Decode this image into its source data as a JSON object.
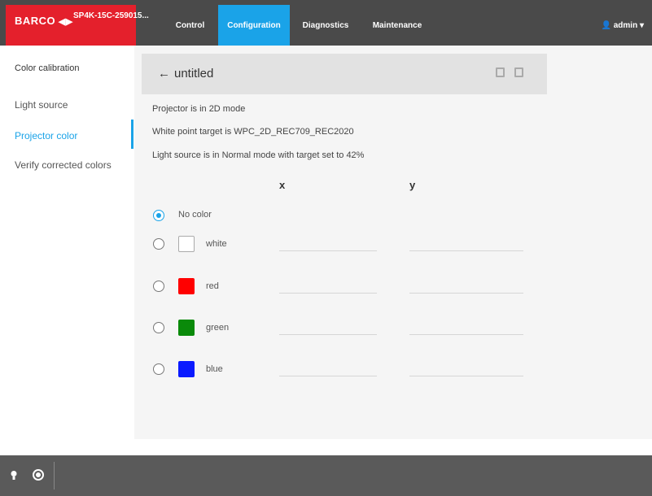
{
  "topbar": {
    "logo": "BARCO",
    "device_name": "SP4K-15C-259015...",
    "tabs": [
      {
        "label": "Control"
      },
      {
        "label": "Configuration"
      },
      {
        "label": "Diagnostics"
      },
      {
        "label": "Maintenance"
      }
    ],
    "user": "admin"
  },
  "sidebar": {
    "title": "Color calibration",
    "items": [
      {
        "label": "Light source"
      },
      {
        "label": "Projector color"
      },
      {
        "label": "Verify corrected colors"
      }
    ]
  },
  "main": {
    "header_title": "untitled",
    "info": [
      "Projector is in 2D mode",
      "White point target is WPC_2D_REC709_REC2020",
      "Light source is in Normal mode with target set to 42%"
    ],
    "col_x": "x",
    "col_y": "y",
    "options": [
      {
        "label": "No color"
      },
      {
        "label": "white",
        "color": "#ffffff"
      },
      {
        "label": "red",
        "color": "#ff0000"
      },
      {
        "label": "green",
        "color": "#0a8a0a"
      },
      {
        "label": "blue",
        "color": "#0a1aff"
      }
    ]
  },
  "colors": {
    "accent": "#1aa3e8",
    "brand": "#e4202c"
  }
}
